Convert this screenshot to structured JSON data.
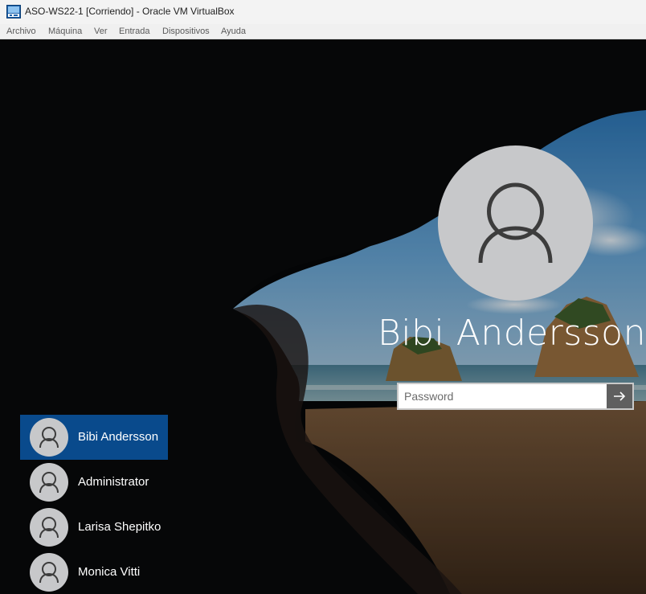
{
  "window": {
    "title": "ASO-WS22-1 [Corriendo] - Oracle VM VirtualBox",
    "icon": "virtualbox-icon"
  },
  "menu": {
    "items": [
      "Archivo",
      "Máquina",
      "Ver",
      "Entrada",
      "Dispositivos",
      "Ayuda"
    ]
  },
  "login": {
    "current_user": "Bibi Andersson",
    "password_placeholder": "Password",
    "submit_icon": "arrow-right-icon"
  },
  "users": [
    {
      "name": "Bibi Andersson",
      "selected": true
    },
    {
      "name": "Administrator",
      "selected": false
    },
    {
      "name": "Larisa Shepitko",
      "selected": false
    },
    {
      "name": "Monica Vitti",
      "selected": false
    }
  ],
  "colors": {
    "selected_tile": "#094a8c",
    "avatar_bg": "#c7c8ca",
    "avatar_glyph": "#3c3c3c",
    "submit_button": "#5f5f5f"
  }
}
